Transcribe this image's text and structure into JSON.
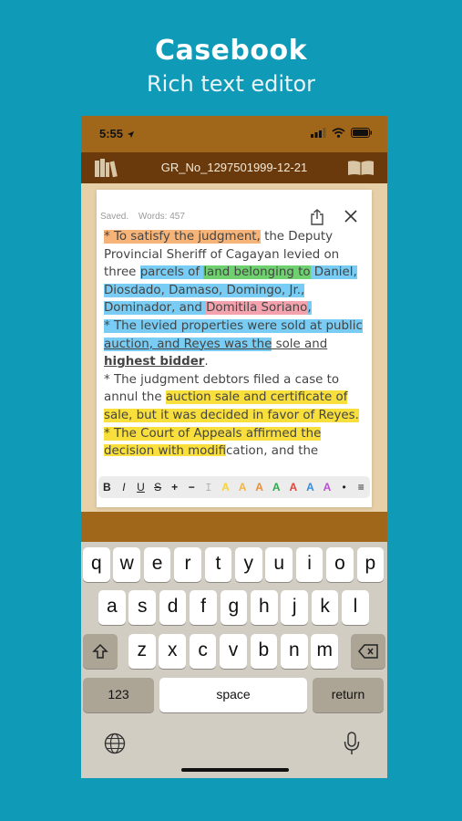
{
  "promo": {
    "title": "Casebook",
    "subtitle": "Rich text editor"
  },
  "status_bar": {
    "time": "5:55"
  },
  "nav": {
    "title": "GR_No_1297501999-12-21",
    "left_icon": "library-books-icon",
    "right_icon": "open-book-icon"
  },
  "editor": {
    "saved_label": "Saved.",
    "words_label": "Words: 457",
    "lines": [
      {
        "spans": [
          {
            "t": "* To satisfy the judgment,",
            "hl": "orange"
          },
          {
            "t": " the Deputy"
          }
        ]
      },
      {
        "spans": [
          {
            "t": "Provincial Sheriff of Cagayan levied on"
          }
        ]
      },
      {
        "spans": [
          {
            "t": "three "
          },
          {
            "t": "parcels of ",
            "hl": "blue"
          },
          {
            "t": "land belonging to",
            "hl": "green"
          },
          {
            "t": " Daniel,",
            "hl": "blue"
          }
        ]
      },
      {
        "spans": [
          {
            "t": "Diosdado, Damaso, Domingo, Jr.,",
            "hl": "blue"
          }
        ]
      },
      {
        "spans": [
          {
            "t": "Dominador, and ",
            "hl": "blue"
          },
          {
            "t": "Domitila Soriano",
            "hl": "pink"
          },
          {
            "t": ",",
            "hl": "blue"
          }
        ]
      },
      {
        "spans": [
          {
            "t": "* The levied properties were sold at public",
            "hl": "blue"
          }
        ]
      },
      {
        "spans": [
          {
            "t": "auction, and Reyes was the",
            "hl": "blue",
            "u": true
          },
          {
            "t": " sole and",
            "u": true
          }
        ]
      },
      {
        "spans": [
          {
            "t": "highest bidder",
            "u": true,
            "b": true
          },
          {
            "t": "."
          }
        ]
      },
      {
        "spans": [
          {
            "t": "* The judgment debtors filed a case to"
          }
        ]
      },
      {
        "spans": [
          {
            "t": "annul the "
          },
          {
            "t": "auction sale and certificate of",
            "hl": "yellow"
          }
        ]
      },
      {
        "spans": [
          {
            "t": "sale, but it was decided in favor of Reyes.",
            "hl": "yellow"
          }
        ]
      },
      {
        "spans": [
          {
            "t": "* The Court of Appeals affirmed the",
            "hl": "yellow"
          }
        ]
      },
      {
        "spans": [
          {
            "t": "decision with modifi",
            "hl": "yellow"
          },
          {
            "t": "cation, and the"
          }
        ]
      }
    ]
  },
  "format_bar": {
    "buttons": [
      {
        "label": "B",
        "name": "bold-button"
      },
      {
        "label": "I",
        "name": "italic-button"
      },
      {
        "label": "U",
        "name": "underline-button"
      },
      {
        "label": "S",
        "name": "strikethrough-button"
      },
      {
        "label": "+",
        "name": "increase-size-button"
      },
      {
        "label": "−",
        "name": "decrease-size-button"
      },
      {
        "label": "𝙸",
        "name": "clear-format-button"
      }
    ],
    "colors": [
      "#f7d23a",
      "#f4b63a",
      "#ea8f2f",
      "#2fa84d",
      "#e0443a",
      "#2f8fe0",
      "#b94fd1"
    ],
    "color_label": "A",
    "dot": "•",
    "menu": "≡"
  },
  "keyboard": {
    "row1": [
      "q",
      "w",
      "e",
      "r",
      "t",
      "y",
      "u",
      "i",
      "o",
      "p"
    ],
    "row2": [
      "a",
      "s",
      "d",
      "f",
      "g",
      "h",
      "j",
      "k",
      "l"
    ],
    "row3": [
      "z",
      "x",
      "c",
      "v",
      "b",
      "n",
      "m"
    ],
    "numbers": "123",
    "space": "space",
    "return": "return"
  }
}
